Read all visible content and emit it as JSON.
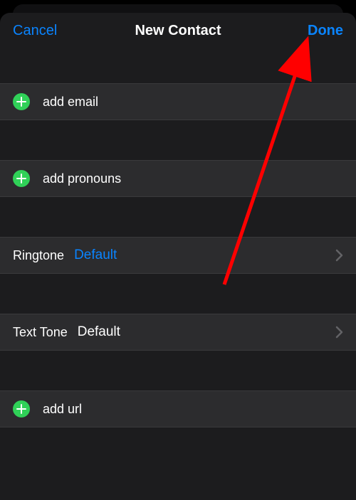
{
  "header": {
    "cancel": "Cancel",
    "title": "New Contact",
    "done": "Done"
  },
  "rows": {
    "addEmail": "add email",
    "addPronouns": "add pronouns",
    "ringtoneLabel": "Ringtone",
    "ringtoneValue": "Default",
    "textToneLabel": "Text Tone",
    "textToneValue": "Default",
    "addUrl": "add url"
  }
}
